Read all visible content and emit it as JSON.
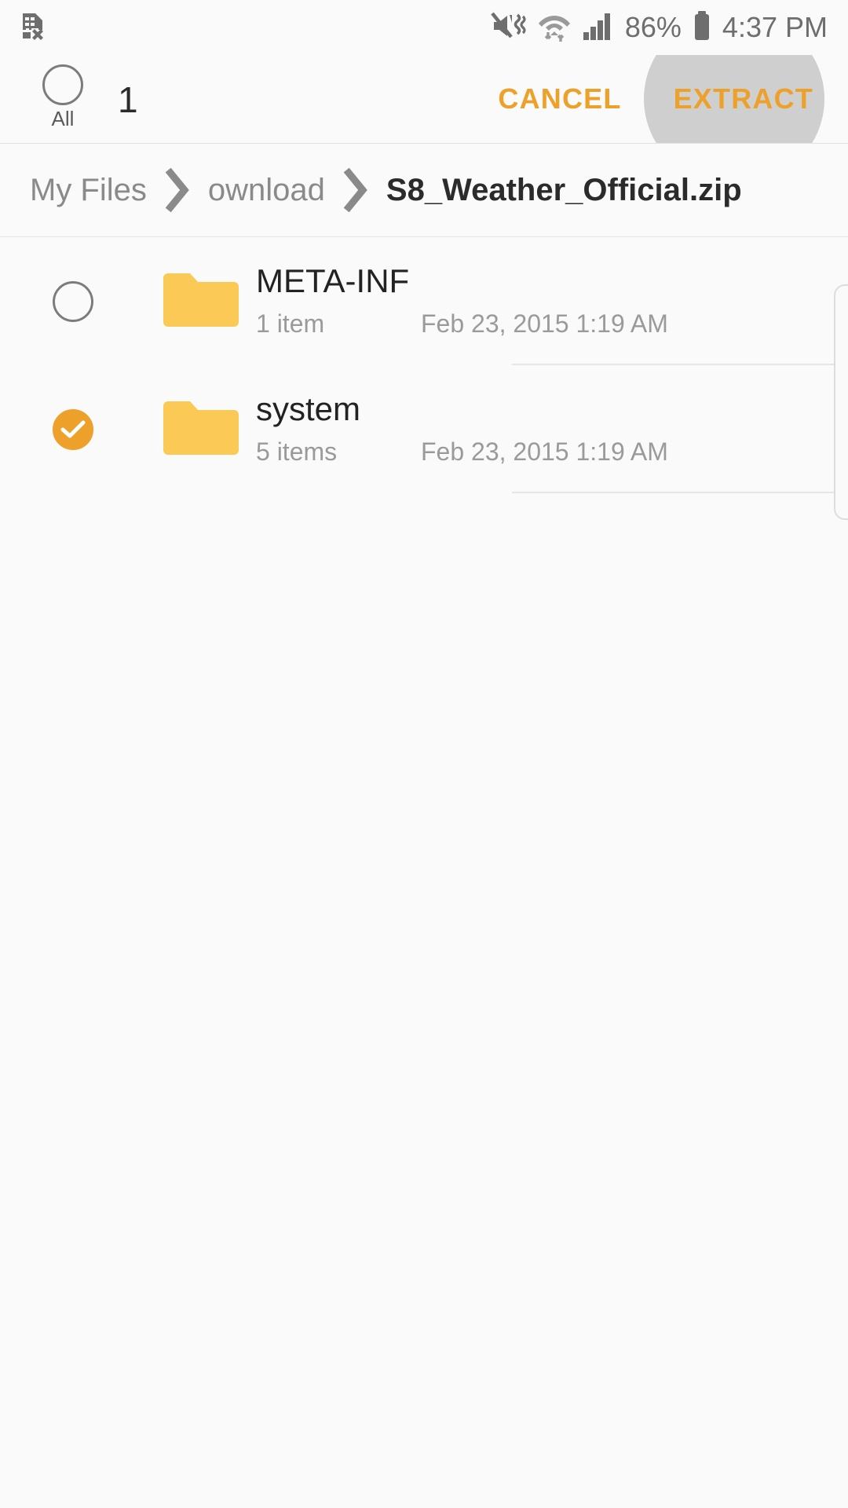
{
  "statusbar": {
    "left_icons": [
      {
        "name": "no-sim-card-icon",
        "label": "No SIM card"
      }
    ],
    "right_icons": [
      {
        "name": "mute-vibrate-icon",
        "label": "Sound muted"
      },
      {
        "name": "wifi-transfer-icon",
        "label": "Wi-Fi connected with data transfer"
      },
      {
        "name": "cellular-signal-icon",
        "label": "Cellular signal full"
      }
    ],
    "battery_percent": "86%",
    "battery_icon": "battery-icon",
    "time": "4:37 PM"
  },
  "actionbar": {
    "select_all_icon": "select-all-circle-icon",
    "select_all_label": "All",
    "selected_count": "1",
    "cancel_label": "CANCEL",
    "extract_label": "EXTRACT",
    "accent_color": "#eda12a",
    "pressed_color": "#cfcfcf"
  },
  "breadcrumb": {
    "separator_icon": "chevron-right-icon",
    "segments": [
      {
        "label": "My Files",
        "current": false
      },
      {
        "label": "ownload",
        "current": false
      },
      {
        "label": "S8_Weather_Official.zip",
        "current": true
      }
    ]
  },
  "filelist": {
    "folder_icon": "folder-icon",
    "checkbox_unchecked_icon": "checkbox-circle-icon",
    "checkbox_checked_icon": "checkbox-circle-checked-icon",
    "rows": [
      {
        "name": "META-INF",
        "count": "1 item",
        "date": "Feb 23, 2015 1:19 AM",
        "selected": false
      },
      {
        "name": "system",
        "count": "5 items",
        "date": "Feb 23, 2015 1:19 AM",
        "selected": true
      }
    ]
  }
}
